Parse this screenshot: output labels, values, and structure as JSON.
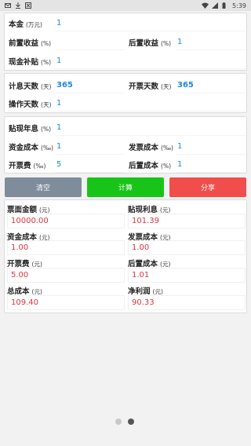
{
  "status_bar": {
    "time": "5:39",
    "left_icons": [
      "mail-icon",
      "download-icon",
      "box-icon"
    ],
    "right_icons": [
      "wifi-icon",
      "signal-icon",
      "battery-icon"
    ]
  },
  "section1": {
    "principal": {
      "label": "本金",
      "unit": "(万元)",
      "value": "1"
    },
    "front_yield": {
      "label": "前置收益",
      "unit": "(%)",
      "value": ""
    },
    "back_yield": {
      "label": "后置收益",
      "unit": "(%)",
      "value": "1"
    },
    "cash_subsidy": {
      "label": "现金补贴",
      "unit": "(%)",
      "value": "1"
    }
  },
  "section2": {
    "interest_days": {
      "label": "计息天数",
      "unit": "(天)",
      "value": "365"
    },
    "invoice_days": {
      "label": "开票天数",
      "unit": "(天)",
      "value": "365"
    },
    "operation_days": {
      "label": "操作天数",
      "unit": "(天)",
      "value": "1"
    }
  },
  "section3": {
    "discount_rate": {
      "label": "贴现年息",
      "unit": "(%)",
      "value": "1"
    },
    "capital_cost": {
      "label": "资金成本",
      "unit": "(‰)",
      "value": "1"
    },
    "invoice_cost": {
      "label": "发票成本",
      "unit": "(‰)",
      "value": "1"
    },
    "invoice_fee": {
      "label": "开票费",
      "unit": "(‰)",
      "value": "5"
    },
    "back_cost": {
      "label": "后置成本",
      "unit": "(%)",
      "value": "1"
    }
  },
  "buttons": {
    "clear": "清空",
    "calculate": "计算",
    "share": "分享"
  },
  "results": {
    "face_amount": {
      "label": "票面金额",
      "unit": "(元)",
      "value": "10000.00"
    },
    "discount_interest": {
      "label": "贴现利息",
      "unit": "(元)",
      "value": "101.39"
    },
    "capital_cost": {
      "label": "资金成本",
      "unit": "(元)",
      "value": "1.00"
    },
    "invoice_cost": {
      "label": "发票成本",
      "unit": "(元)",
      "value": "1.00"
    },
    "invoice_fee": {
      "label": "开票费",
      "unit": "(元)",
      "value": "5.00"
    },
    "back_cost": {
      "label": "后置成本",
      "unit": "(元)",
      "value": "1.01"
    },
    "total_cost": {
      "label": "总成本",
      "unit": "(元)",
      "value": "109.40"
    },
    "net_profit": {
      "label": "净利润",
      "unit": "(元)",
      "value": "90.33"
    }
  },
  "pager": {
    "pages": 2,
    "current": 2
  }
}
